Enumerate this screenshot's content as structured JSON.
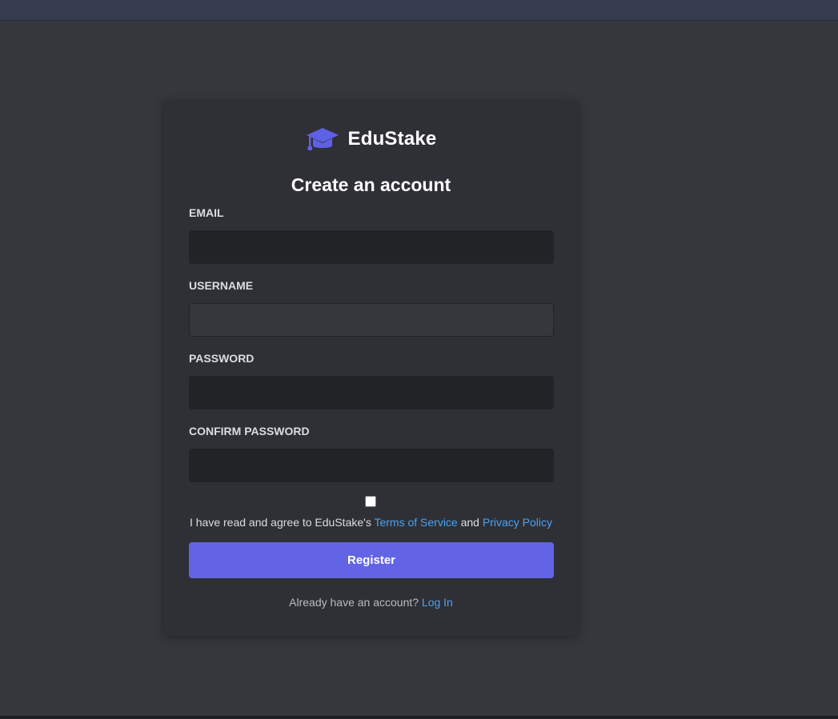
{
  "app": {
    "brand_name": "EduStake",
    "logo_icon": "graduation-cap-icon"
  },
  "form": {
    "heading": "Create an account",
    "email": {
      "label": "EMAIL",
      "value": "",
      "placeholder": ""
    },
    "username": {
      "label": "USERNAME",
      "value": "",
      "placeholder": ""
    },
    "password": {
      "label": "PASSWORD",
      "value": "",
      "placeholder": ""
    },
    "confirm_password": {
      "label": "CONFIRM PASSWORD",
      "value": "",
      "placeholder": ""
    },
    "agree": {
      "checked": false,
      "prefix": "I have read and agree to EduStake's",
      "terms_link": "Terms of Service",
      "conjunction": "and",
      "privacy_link": "Privacy Policy"
    },
    "register_button": "Register",
    "login_prompt": "Already have an account?",
    "login_link": "Log In"
  },
  "colors": {
    "background": "#36373d",
    "top_bar": "#363c50",
    "card": "#2f3035",
    "input": "#222327",
    "accent": "#6264e5",
    "link": "#4aa1f3",
    "logo": "#5e60e6"
  }
}
